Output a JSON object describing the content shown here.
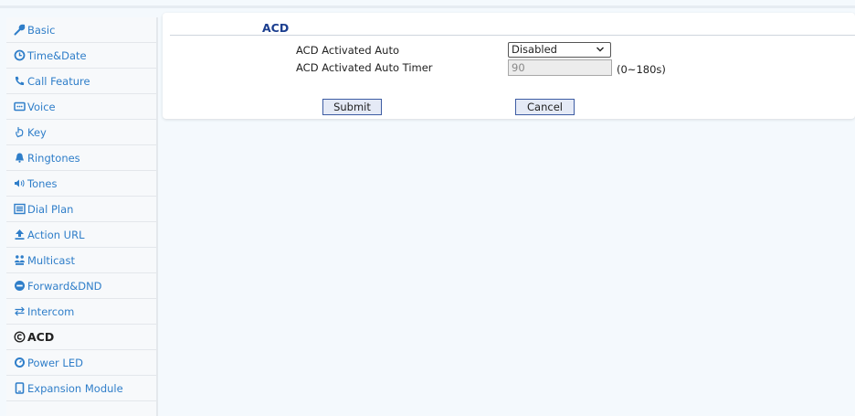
{
  "sidebar": {
    "items": [
      {
        "label": "Basic",
        "icon": "wrench-icon"
      },
      {
        "label": "Time&Date",
        "icon": "clock-icon"
      },
      {
        "label": "Call Feature",
        "icon": "phone-icon"
      },
      {
        "label": "Voice",
        "icon": "voice-icon"
      },
      {
        "label": "Key",
        "icon": "key-icon"
      },
      {
        "label": "Ringtones",
        "icon": "bell-icon"
      },
      {
        "label": "Tones",
        "icon": "speaker-icon"
      },
      {
        "label": "Dial Plan",
        "icon": "list-icon"
      },
      {
        "label": "Action URL",
        "icon": "upload-icon"
      },
      {
        "label": "Multicast",
        "icon": "group-icon"
      },
      {
        "label": "Forward&DND",
        "icon": "minus-circle-icon"
      },
      {
        "label": "Intercom",
        "icon": "arrows-icon"
      },
      {
        "label": "ACD",
        "icon": "copyright-icon",
        "active": true
      },
      {
        "label": "Power LED",
        "icon": "gauge-icon"
      },
      {
        "label": "Expansion Module",
        "icon": "device-icon"
      }
    ],
    "link_color": "#2f7ec9"
  },
  "panel": {
    "title": "ACD",
    "fields": {
      "auto_label": "ACD Activated Auto",
      "auto_value": "Disabled",
      "timer_label": "ACD Activated Auto Timer",
      "timer_value": "90",
      "timer_range": "(0~180s)"
    },
    "submit_label": "Submit",
    "cancel_label": "Cancel"
  }
}
